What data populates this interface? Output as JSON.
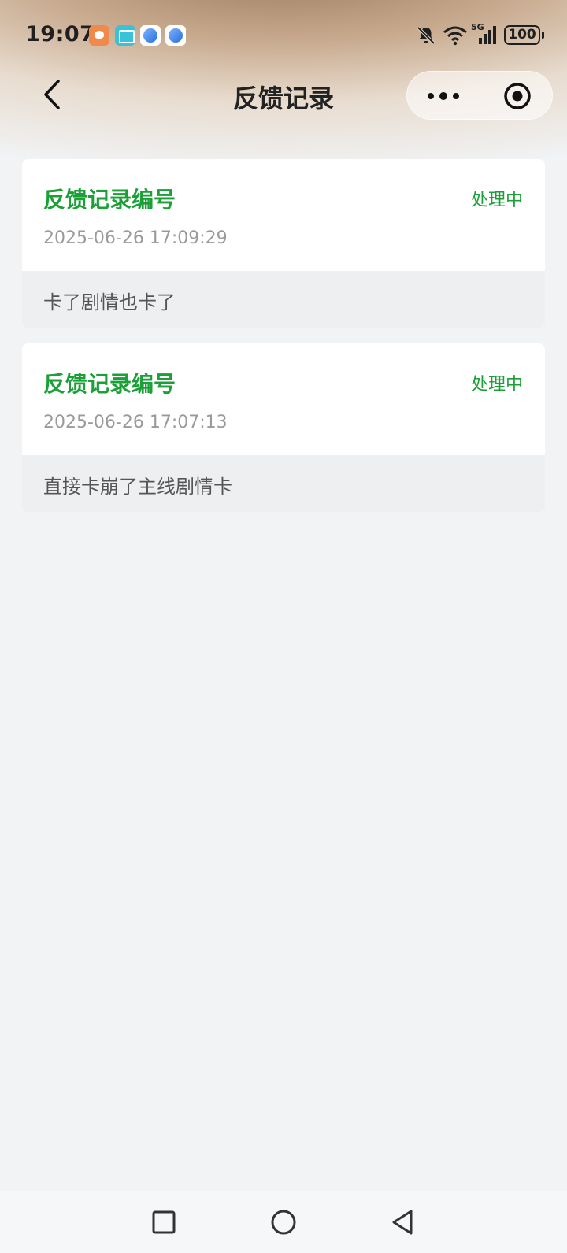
{
  "status_bar": {
    "time": "19:07",
    "network": "5G",
    "battery": "100"
  },
  "nav": {
    "title": "反馈记录"
  },
  "records": [
    {
      "title": "反馈记录编号",
      "status": "处理中",
      "time": "2025-06-26 17:09:29",
      "content": "卡了剧情也卡了"
    },
    {
      "title": "反馈记录编号",
      "status": "处理中",
      "time": "2025-06-26 17:07:13",
      "content": "直接卡崩了主线剧情卡"
    }
  ],
  "colors": {
    "accent": "#1aa037",
    "page_bg": "#f1f3f5"
  },
  "icons": {
    "back": "chevron-left-icon",
    "more": "more-dots-icon",
    "close": "target-circle-icon"
  }
}
